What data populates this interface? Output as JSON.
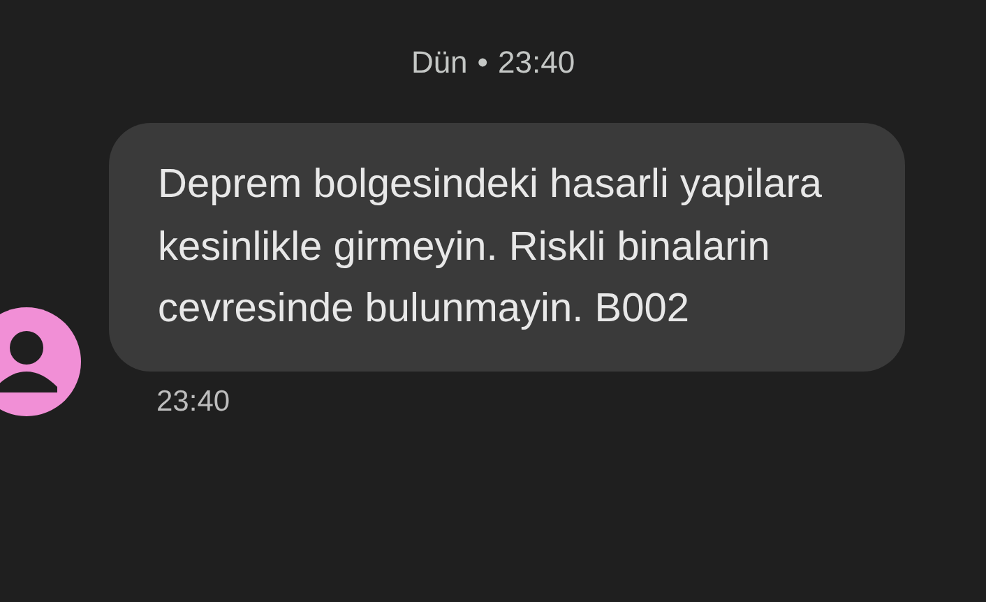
{
  "header": {
    "date": "Dün",
    "separator": "•",
    "time": "23:40"
  },
  "message": {
    "text": "Deprem bolgesindeki hasarli yapilara kesinlikle girmeyin. Riskli binalarin cevresinde bulunmayin. B002",
    "time": "23:40"
  }
}
